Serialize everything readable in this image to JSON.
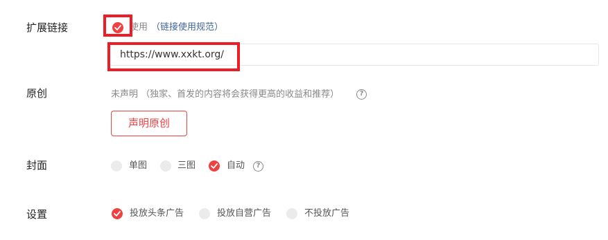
{
  "rows": {
    "ext_link": {
      "label": "扩展链接",
      "use_label": "使用",
      "rules_link": "（链接使用规范）",
      "url_value": "https://www.xxkt.org/",
      "checked": true
    },
    "original": {
      "label": "原创",
      "hint": "未声明 （独家、首发的内容将会获得更高的收益和推荐）",
      "declare_button": "声明原创",
      "help_glyph": "?"
    },
    "cover": {
      "label": "封面",
      "options": [
        {
          "label": "单图",
          "selected": false
        },
        {
          "label": "三图",
          "selected": false
        },
        {
          "label": "自动",
          "selected": true
        }
      ],
      "help_glyph": "?"
    },
    "settings": {
      "label": "设置",
      "options": [
        {
          "label": "投放头条广告",
          "selected": true
        },
        {
          "label": "投放自营广告",
          "selected": false
        },
        {
          "label": "不投放广告",
          "selected": false
        }
      ]
    }
  },
  "colors": {
    "accent": "#f04142",
    "highlight": "#ee1c24",
    "link": "#406599",
    "muted": "#888888"
  }
}
